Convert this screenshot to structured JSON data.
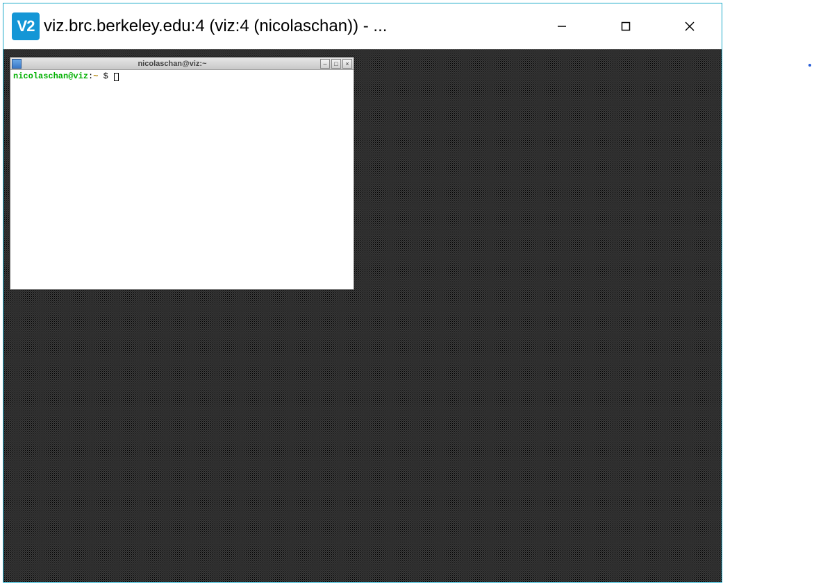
{
  "vncViewer": {
    "iconText": "V2",
    "title": "viz.brc.berkeley.edu:4 (viz:4 (nicolaschan)) - ..."
  },
  "terminal": {
    "title": "nicolaschan@viz:~",
    "promptUserHost": "nicolaschan@viz",
    "promptColon": ":",
    "promptPath": "~",
    "promptSymbol": " $ "
  }
}
